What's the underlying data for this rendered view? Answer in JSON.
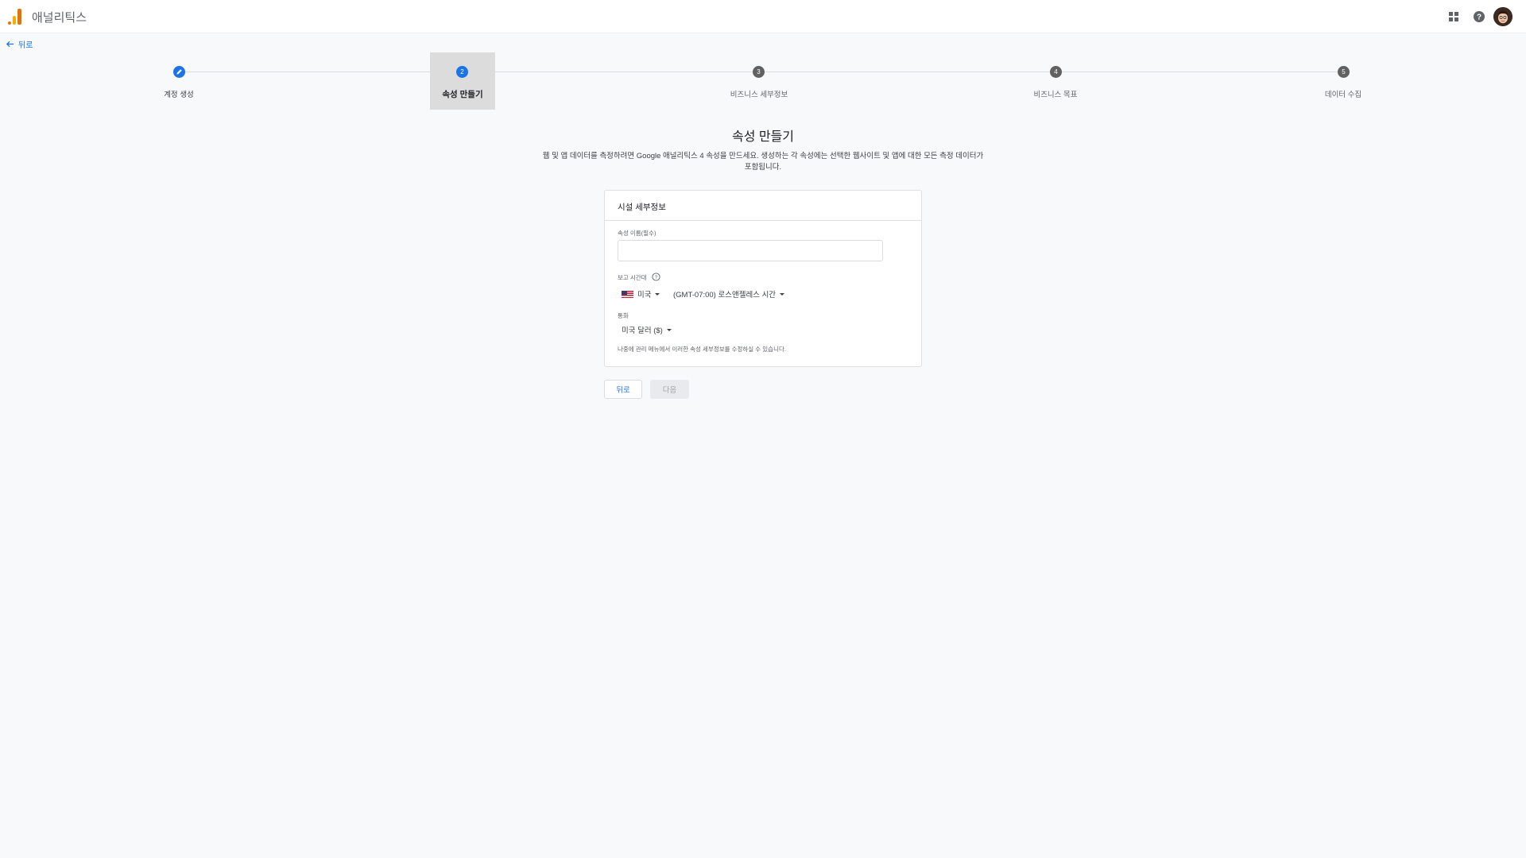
{
  "header": {
    "app_title": "애널리틱스",
    "icons": [
      "analytics-logo",
      "apps-icon",
      "help-icon",
      "avatar"
    ]
  },
  "nav": {
    "back_label": "뒤로"
  },
  "stepper": {
    "steps": [
      {
        "number": "",
        "label": "계정 생성",
        "state": "done"
      },
      {
        "number": "2",
        "label": "속성 만들기",
        "state": "active"
      },
      {
        "number": "3",
        "label": "비즈니스 세부정보",
        "state": "pending"
      },
      {
        "number": "4",
        "label": "비즈니스 목표",
        "state": "pending"
      },
      {
        "number": "5",
        "label": "데이터 수집",
        "state": "pending"
      }
    ]
  },
  "main": {
    "title": "속성 만들기",
    "description_line1": "웹 및 앱 데이터를 측정하려면 Google 애널리틱스 4 속성을 만드세요. 생성하는 각 속성에는 선택한 웹사이트 및 앱에 대한 모든 측정 데이터가",
    "description_line2": "포함됩니다."
  },
  "card": {
    "header": "시설 세부정보",
    "property_name_label": "속성 이름(필수)",
    "property_name_value": "",
    "timezone_label": "보고 시간대",
    "country_value": "미국",
    "timezone_value": "(GMT-07:00) 로스앤젤레스 시간",
    "currency_label": "통화",
    "currency_value": "미국 달러 ($)",
    "note": "나중에 관리 메뉴에서 이러한 속성 세부정보를 수정하실 수 있습니다."
  },
  "buttons": {
    "back": "뒤로",
    "next": "다음"
  },
  "colors": {
    "accent": "#1a73e8",
    "step_pending": "#616161",
    "logo_orange": "#f9ab00",
    "logo_dark_orange": "#e37400",
    "background": "#f8f9fa"
  }
}
